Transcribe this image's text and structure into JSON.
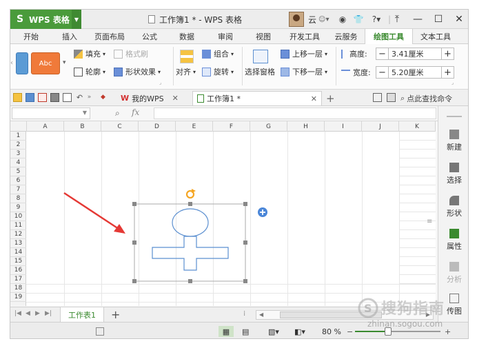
{
  "app": {
    "name": "WPS 表格",
    "doc_title": "工作簿1 * - WPS 表格",
    "user": "云"
  },
  "ribbon_tabs": [
    {
      "label": "开始"
    },
    {
      "label": "插入"
    },
    {
      "label": "页面布局"
    },
    {
      "label": "公式"
    },
    {
      "label": "数据"
    },
    {
      "label": "审阅"
    },
    {
      "label": "视图"
    },
    {
      "label": "开发工具"
    },
    {
      "label": "云服务"
    },
    {
      "label": "绘图工具",
      "active": true
    },
    {
      "label": "文本工具"
    }
  ],
  "ribbon": {
    "style_preview": "Abc",
    "fill": "填充",
    "format_painter": "格式刷",
    "outline": "轮廓",
    "shape_effects": "形状效果",
    "align": "对齐",
    "group": "组合",
    "rotate": "旋转",
    "selection_pane": "选择窗格",
    "bring_forward": "上移一层",
    "send_backward": "下移一层",
    "height_label": "高度:",
    "height_value": "3.41厘米",
    "width_label": "宽度:",
    "width_value": "5.20厘米"
  },
  "doc_tabs": [
    {
      "label": "我的WPS"
    },
    {
      "label": "工作簿1 *"
    }
  ],
  "search_command": "点此查找命令",
  "formula_fx": "fx",
  "columns": [
    "A",
    "B",
    "C",
    "D",
    "E",
    "F",
    "G",
    "H",
    "I",
    "J",
    "K"
  ],
  "rows": [
    "1",
    "2",
    "3",
    "4",
    "5",
    "6",
    "7",
    "8",
    "9",
    "10",
    "11",
    "12",
    "13",
    "14",
    "15",
    "16",
    "17",
    "18",
    "19"
  ],
  "right_panel": [
    {
      "label": "新建"
    },
    {
      "label": "选择"
    },
    {
      "label": "形状"
    },
    {
      "label": "属性"
    },
    {
      "label": "分析"
    },
    {
      "label": "传图"
    }
  ],
  "sheet_tab": "工作表1",
  "zoom": {
    "label": "80 %",
    "percent": 80
  },
  "watermark": {
    "brand": "搜狗指南",
    "url": "zhinan.sogou.com"
  },
  "colors": {
    "accent": "#3a8a2f",
    "shape_stroke": "#5b8fd0",
    "arrow": "#e53935",
    "handle": "#888888"
  }
}
